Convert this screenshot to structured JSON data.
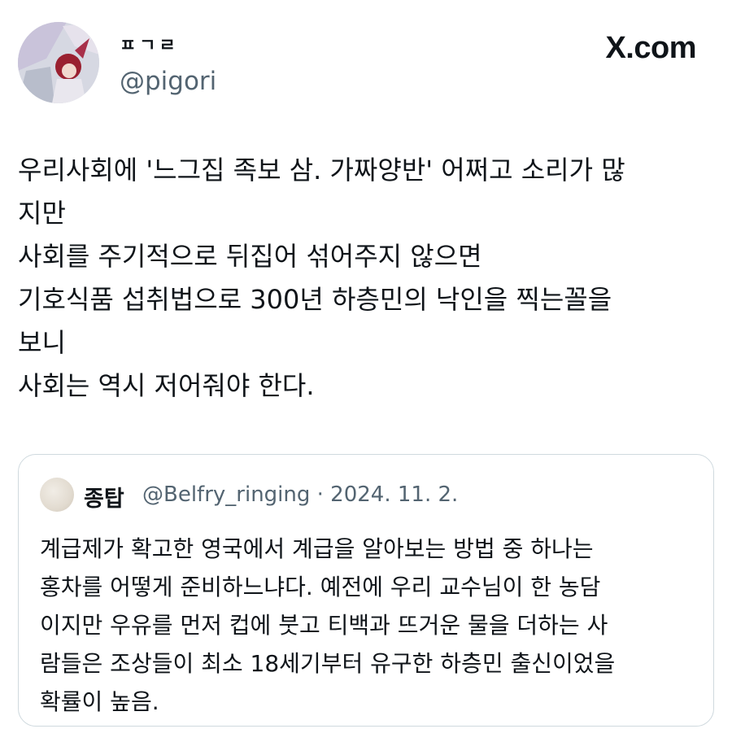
{
  "header": {
    "display_name": "ㅍㄱㄹ",
    "handle": "@pigori",
    "brand": "X.com",
    "avatar_icon": "anime-character-avatar"
  },
  "tweet": {
    "lines": [
      "우리사회에 '느그집 족보 삼. 가짜양반' 어쩌고 소리가 많",
      "지만",
      "사회를 주기적으로 뒤집어 섞어주지 않으면",
      "기호식품 섭취법으로 300년 하층민의 낙인을 찍는꼴을",
      "보니",
      "사회는 역시 저어줘야 한다."
    ]
  },
  "quote": {
    "display_name": "종탑",
    "meta": "@Belfry_ringing · 2024. 11. 2.",
    "avatar_icon": "paper-texture-avatar",
    "lines": [
      "계급제가 확고한 영국에서 계급을 알아보는 방법 중 하나는",
      "홍차를 어떻게 준비하느냐다. 예전에 우리 교수님이 한 농담",
      "이지만 우유를 먼저 컵에 붓고 티백과 뜨거운 물을 더하는 사",
      "람들은 조상들이 최소 18세기부터 유구한 하층민 출신이었을",
      "확률이 높음."
    ]
  }
}
